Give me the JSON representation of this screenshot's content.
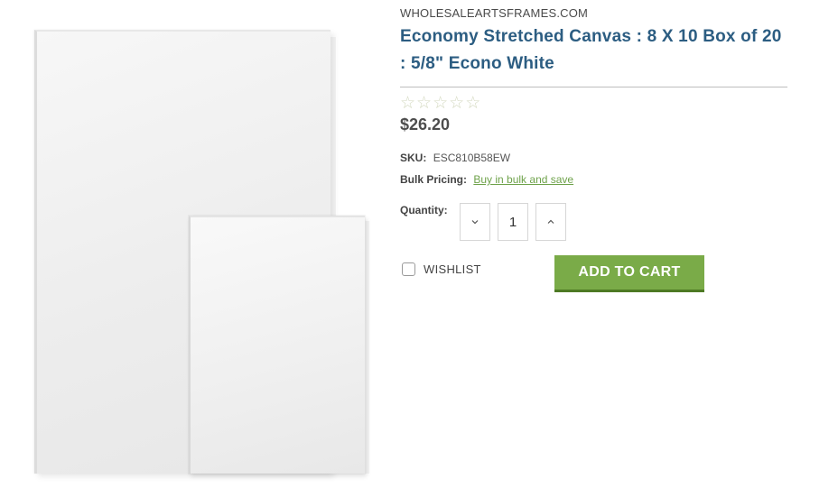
{
  "product": {
    "brand": "WHOLESALEARTSFRAMES.COM",
    "title": "Economy Stretched Canvas : 8 X 10 Box of 20 : 5/8\" Econo White",
    "rating": {
      "stars_filled": 0,
      "stars_total": 5,
      "icon": "star-outline-icon"
    },
    "price": "$26.20",
    "sku": {
      "label": "SKU:",
      "value": "ESC810B58EW"
    },
    "bulk_pricing": {
      "label": "Bulk Pricing:",
      "link_text": "Buy in bulk and save"
    },
    "quantity": {
      "label": "Quantity:",
      "value": "1",
      "decrement_icon": "chevron-down-icon",
      "increment_icon": "chevron-up-icon"
    },
    "wishlist": {
      "label": "WISHLIST",
      "checked": false
    },
    "add_to_cart": {
      "label": "ADD TO CART"
    }
  },
  "colors": {
    "title": "#2c5d82",
    "link": "#6ea24a",
    "button": "#7aab48",
    "button_shadow": "#4d7a24"
  }
}
